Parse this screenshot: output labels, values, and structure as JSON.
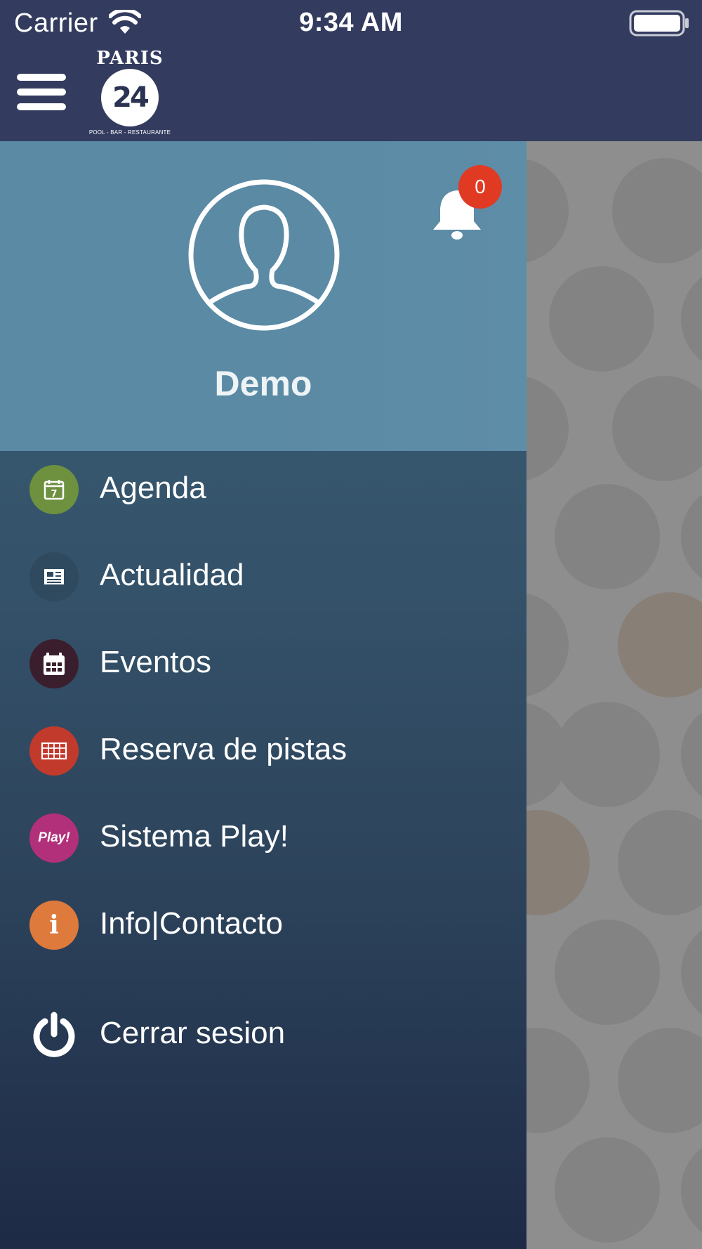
{
  "status_bar": {
    "carrier": "Carrier",
    "time": "9:34 AM"
  },
  "nav": {
    "logo": {
      "top_text": "PARIS",
      "number": "24",
      "tagline": "POOL - BAR - RESTAURANTE"
    }
  },
  "profile": {
    "username": "Demo",
    "notifications_count": "0"
  },
  "menu": {
    "items": [
      {
        "label": "Agenda",
        "icon": "calendar-day-icon",
        "color": "#6e9140"
      },
      {
        "label": "Actualidad",
        "icon": "newspaper-icon",
        "color": "#2f4a5e"
      },
      {
        "label": "Eventos",
        "icon": "calendar-grid-icon",
        "color": "#3b1e2d"
      },
      {
        "label": "Reserva de pistas",
        "icon": "court-icon",
        "color": "#c23a2c"
      },
      {
        "label": "Sistema Play!",
        "icon": "play-badge-icon",
        "icon_text": "Play!",
        "color": "#b2307a"
      },
      {
        "label": "Info|Contacto",
        "icon": "info-icon",
        "icon_text": "i",
        "color": "#de7a3c"
      }
    ],
    "logout": {
      "label": "Cerrar sesion",
      "icon": "power-icon"
    }
  },
  "colors": {
    "nav_bar": "#333c5f",
    "profile_header": "#5b8aa4",
    "badge": "#e13a23"
  }
}
